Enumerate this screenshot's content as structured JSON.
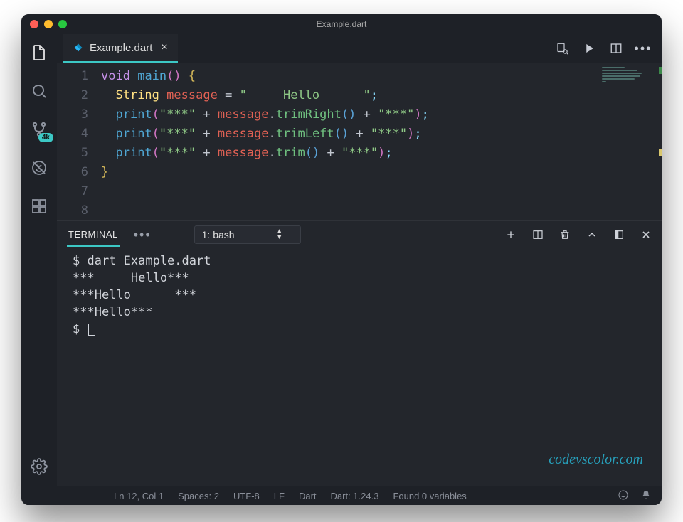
{
  "window": {
    "title": "Example.dart"
  },
  "tab": {
    "filename": "Example.dart",
    "close": "×"
  },
  "activity": {
    "badge": "4k"
  },
  "code": {
    "lines": [
      "1",
      "2",
      "3",
      "4",
      "5",
      "6",
      "7",
      "8"
    ],
    "l1": {
      "kw": "void",
      "fn": "main",
      "paren": "()",
      "brace": "{"
    },
    "l2": {
      "type": "String",
      "var": "message",
      "eq": "=",
      "str": "\"     Hello      \"",
      "semi": ";"
    },
    "l3": {
      "fn": "print",
      "str1": "\"***\"",
      "plus1": "+",
      "var": "message",
      "dot": ".",
      "call": "trimRight",
      "paren": "()",
      "plus2": "+",
      "str2": "\"***\"",
      "semi": ";"
    },
    "l4": {
      "fn": "print",
      "str1": "\"***\"",
      "plus1": "+",
      "var": "message",
      "dot": ".",
      "call": "trimLeft",
      "paren": "()",
      "plus2": "+",
      "str2": "\"***\"",
      "semi": ";"
    },
    "l5": {
      "fn": "print",
      "str1": "\"***\"",
      "plus1": "+",
      "var": "message",
      "dot": ".",
      "call": "trim",
      "paren": "()",
      "plus2": "+",
      "str2": "\"***\"",
      "semi": ";"
    },
    "l6": {
      "brace": "}"
    }
  },
  "panel": {
    "tab": "TERMINAL",
    "select": "1: bash",
    "lines": {
      "cmd": "$ dart Example.dart",
      "o1": "***     Hello***",
      "o2": "***Hello      ***",
      "o3": "***Hello***",
      "prompt": "$ "
    }
  },
  "status": {
    "pos": "Ln 12, Col 1",
    "spaces": "Spaces: 2",
    "enc": "UTF-8",
    "eol": "LF",
    "lang": "Dart",
    "sdk": "Dart: 1.24.3",
    "vars": "Found 0 variables"
  },
  "watermark": "codevscolor.com"
}
